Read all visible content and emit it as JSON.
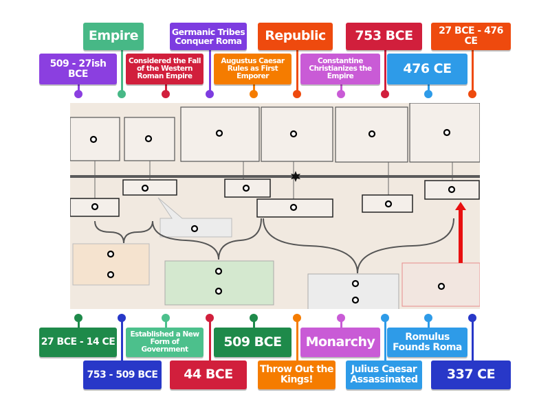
{
  "diagram": {
    "description_icons": [
      "timeline-star-icon",
      "red-arrow-icon"
    ],
    "colors": {
      "background": "#f1e9e0",
      "timeline": "#5a5a5a",
      "tan_scroll": "#f5e3cf",
      "green_scroll": "#d4e8cf",
      "gray_scroll": "#ececec",
      "red_box_border": "#e88a8a",
      "arrow": "#e81010"
    }
  },
  "labels_top": [
    {
      "text": "Empire",
      "color": "#47b886"
    },
    {
      "text": "Germanic Tribes Conquer Roma",
      "color": "#7d3ce0"
    },
    {
      "text": "Republic",
      "color": "#ee4a0e"
    },
    {
      "text": "753 BCE",
      "color": "#d11f3c"
    },
    {
      "text": "27 BCE - 476 CE",
      "color": "#ee4a0e"
    },
    {
      "text": "509 - 27ish BCE",
      "color": "#8b3fe0"
    },
    {
      "text": "Considered the Fall of the Western Roman Empire",
      "color": "#d11f3c"
    },
    {
      "text": "Augustus Caesar Rules as First Emporer",
      "color": "#f57c00"
    },
    {
      "text": "Constantine Christianizes the Empire",
      "color": "#c95bd6"
    },
    {
      "text": "476 CE",
      "color": "#2e9be8"
    }
  ],
  "labels_bottom": [
    {
      "text": "27 BCE - 14 CE",
      "color": "#1e8a4a"
    },
    {
      "text": "Established a New Form of Government",
      "color": "#4cc08c"
    },
    {
      "text": "509 BCE",
      "color": "#1e8a4a"
    },
    {
      "text": "Monarchy",
      "color": "#c95bd6"
    },
    {
      "text": "Romulus Founds Roma",
      "color": "#2e9be8"
    },
    {
      "text": "753 - 509 BCE",
      "color": "#2838c8"
    },
    {
      "text": "44 BCE",
      "color": "#d11f3c"
    },
    {
      "text": "Throw Out the Kings!",
      "color": "#f57c00"
    },
    {
      "text": "Julius Caesar Assassinated",
      "color": "#2e9be8"
    },
    {
      "text": "337 CE",
      "color": "#2838c8"
    }
  ]
}
